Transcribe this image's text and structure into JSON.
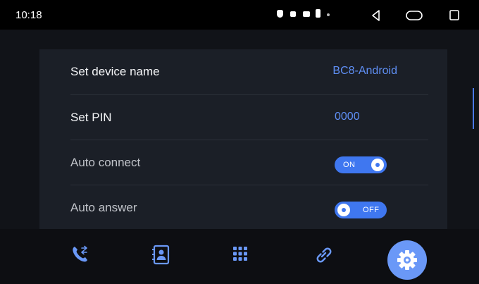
{
  "status_bar": {
    "time": "10:18"
  },
  "settings": [
    {
      "label": "Set device name",
      "value": "BC8-Android"
    },
    {
      "label": "Set PIN",
      "value": "0000"
    },
    {
      "label": "Auto connect",
      "toggle_label": "ON",
      "toggle_on": true
    },
    {
      "label": "Auto answer",
      "toggle_label": "OFF",
      "toggle_on": false
    }
  ],
  "bottom_nav": {
    "icons": [
      "phone-transfer-icon",
      "contacts-icon",
      "dialpad-icon",
      "link-icon",
      "settings-icon"
    ],
    "active": "settings-icon"
  },
  "colors": {
    "accent": "#3f77f0",
    "active_nav": "#6a98f7",
    "value_text": "#5f8ff5"
  }
}
